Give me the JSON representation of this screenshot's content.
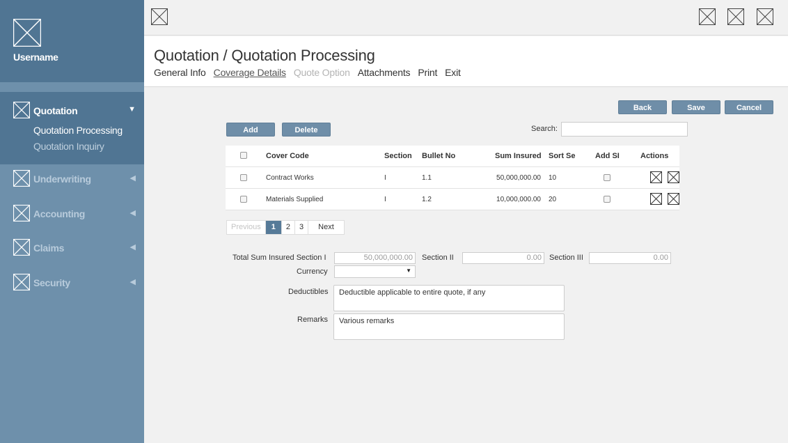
{
  "sidebar": {
    "username": "Username",
    "items": [
      {
        "label": "Quotation",
        "arrow": "▼"
      },
      {
        "label": "Underwriting",
        "arrow": "◀"
      },
      {
        "label": "Accounting",
        "arrow": "◀"
      },
      {
        "label": "Claims",
        "arrow": "◀"
      },
      {
        "label": "Security",
        "arrow": "◀"
      }
    ],
    "subitems": [
      "Quotation Processing",
      "Quotation Inquiry"
    ]
  },
  "header": {
    "title": "Quotation / Quotation Processing",
    "tabs": [
      "General Info",
      "Coverage Details",
      "Quote Option",
      "Attachments",
      "Print",
      "Exit"
    ]
  },
  "toolbar": {
    "back": "Back",
    "save": "Save",
    "cancel": "Cancel"
  },
  "table_actions": {
    "add": "Add",
    "delete": "Delete"
  },
  "search": {
    "label": "Search:",
    "value": ""
  },
  "table": {
    "headers": [
      "Cover Code",
      "Section",
      "Bullet No",
      "Sum Insured",
      "Sort Se",
      "Add SI",
      "Actions"
    ],
    "rows": [
      {
        "cover_code": "Contract Works",
        "section": "I",
        "bullet_no": "1.1",
        "sum_insured": "50,000,000.00",
        "sort": "10"
      },
      {
        "cover_code": "Materials Supplied",
        "section": "I",
        "bullet_no": "1.2",
        "sum_insured": "10,000,000.00",
        "sort": "20"
      }
    ]
  },
  "pagination": {
    "previous": "Previous",
    "pages": [
      "1",
      "2",
      "3"
    ],
    "next": "Next"
  },
  "form": {
    "total_label": "Total Sum Insured Section I",
    "total_value": "50,000,000.00",
    "section2_label": "Section II",
    "section2_value": "0.00",
    "section3_label": "Section III",
    "section3_value": "0.00",
    "currency_label": "Currency",
    "currency_value": "",
    "deductibles_label": "Deductibles",
    "deductibles_value": "Deductible applicable to entire quote, if any",
    "remarks_label": "Remarks",
    "remarks_value": "Various remarks"
  }
}
